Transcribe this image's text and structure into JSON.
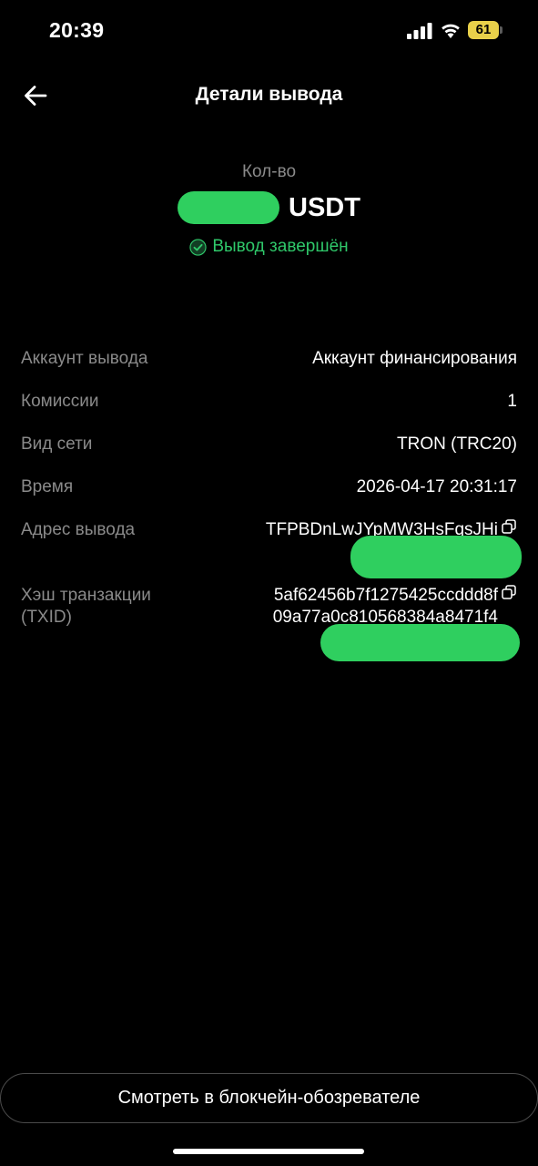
{
  "status_bar": {
    "time": "20:39",
    "battery": "61"
  },
  "header": {
    "title": "Детали вывода"
  },
  "amount": {
    "label": "Кол-во",
    "currency": "USDT"
  },
  "status": {
    "text": "Вывод завершён"
  },
  "details": {
    "account": {
      "label": "Аккаунт вывода",
      "value": "Аккаунт финансирования"
    },
    "fee": {
      "label": "Комиссии",
      "value": "1"
    },
    "network": {
      "label": "Вид сети",
      "value": "TRON (TRC20)"
    },
    "time": {
      "label": "Время",
      "value": "2026-04-17 20:31:17"
    },
    "address": {
      "label": "Адрес вывода",
      "value": "TFPBDnLwJYpMW3HsFqsJHi"
    },
    "txid": {
      "label_line1": "Хэш транзакции",
      "label_line2": "(TXID)",
      "value_line1": "5af62456b7f1275425ccddd8f",
      "value_line2": "09a77a0c810568384a8471f4"
    }
  },
  "footer": {
    "explorer_button": "Смотреть в блокчейн-обозревателе"
  },
  "colors": {
    "background": "#000000",
    "accent_green": "#2fc86a",
    "muted_text": "#8a8a8a",
    "battery": "#e8d04a"
  },
  "icons": {
    "back": "arrow-left-icon",
    "status": "check-circle-icon",
    "copy": "copy-icon"
  }
}
